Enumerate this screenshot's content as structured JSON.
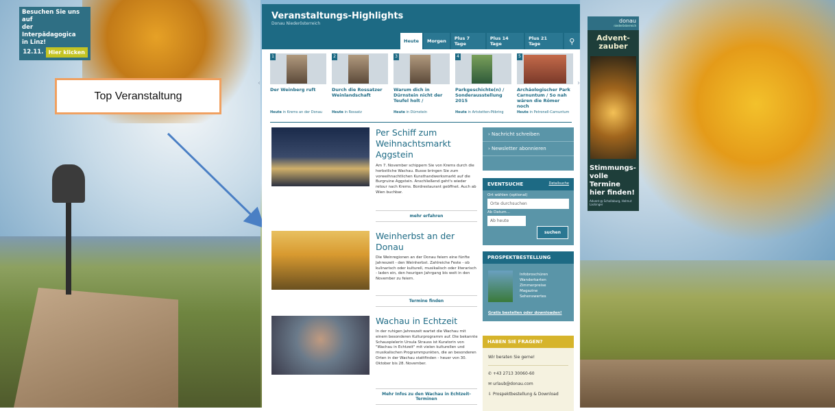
{
  "ad_left": {
    "line1": "Besuchen Sie uns auf",
    "line2": "der Interpädagogica",
    "line3": "in Linz!",
    "dates": "12.11. - 14.11.2015",
    "button": "Hier klicken"
  },
  "annotation": {
    "label": "Top Veranstaltung"
  },
  "header": {
    "title": "Veranstaltungs-Highlights",
    "subtitle": "Donau Niederösterreich"
  },
  "tabs": [
    "Heute",
    "Morgen",
    "Plus 7 Tage",
    "Plus 14 Tage",
    "Plus 21 Tage"
  ],
  "highlights": [
    {
      "num": "1",
      "title": "Der Weinberg ruft",
      "when": "Heute",
      "where": "in Krems an der Donau"
    },
    {
      "num": "2",
      "title": "Durch die Rossatzer Weinlandschaft",
      "when": "Heute",
      "where": "in Rossatz"
    },
    {
      "num": "3",
      "title": "Warum dich in Dürnstein nicht der Teufel holt /",
      "when": "Heute",
      "where": "in Dürnstein"
    },
    {
      "num": "4",
      "title": "Parkgeschichte(n) / Sonderausstellung 2015",
      "when": "Heute",
      "where": "in Artstetten-Pöbring"
    },
    {
      "num": "5",
      "title": "Archäologischer Park Carnuntum / So nah wären die Römer noch",
      "when": "Heute",
      "where": "in Petronell-Carnuntum"
    }
  ],
  "articles": [
    {
      "title": "Per Schiff zum Weihnachtsmarkt Aggstein",
      "text": "Am 7. November schippern Sie von Krems durch die herbstliche Wachau. Busse bringen Sie zum vorweihnachtlichen Kunsthandwerksmarkt auf die Burgruine Aggstein. Anschließend geht's wieder retour nach Krems. Bordrestaurant geöffnet. Auch ab Wien buchbar.",
      "link": "mehr erfahren"
    },
    {
      "title": "Weinherbst an der Donau",
      "text": "Die Weinregionen an der Donau feiern eine fünfte Jahreszeit - den Weinherbst. Zahlreiche Feste - ob kulinarisch oder kulturell, musikalisch oder literarisch - laden ein, den heurigen Jahrgang bis weit in den November zu feiern.",
      "link": "Termine finden"
    },
    {
      "title": "Wachau in Echtzeit",
      "text": "In der ruhigen Jahreszeit wartet die Wachau mit einem besonderen Kulturprogramm auf. Die bekannte Schauspielerin Ursula Strauss ist Kuratorin von \"Wachau in Echtzeit\" mit vielen kulturellen und musikalischen Programmpunkten, die an besonderen Orten in der Wachau stattfinden - heuer von 30. Oktober bis 28. November.",
      "link": "Mehr Infos zu den Wachau in Echtzeit-Terminen"
    }
  ],
  "sidebar": {
    "newsletter": [
      "Nachricht schreiben",
      "Newsletter abonnieren"
    ],
    "eventsuche": {
      "title": "EVENTSUCHE",
      "detail": "Detailsuche",
      "ort_label": "Ort wählen (optional)",
      "ort_placeholder": "Orte durchsuchen",
      "datum_label": "Ab Datum...",
      "datum_value": "Ab heute",
      "button": "suchen"
    },
    "prospekt": {
      "title": "PROSPEKTBESTELLUNG",
      "items": [
        "Infobroschüren",
        "Wanderkarten",
        "Zimmerpreise",
        "Magazine",
        "Sehenswertes"
      ],
      "link": "Gratis bestellen oder downloaden!"
    },
    "fragen": {
      "title": "HABEN SIE FRAGEN?",
      "intro": "Wir beraten Sie gerne!",
      "phone": "+43 2713 30060-60",
      "email": "urlaub@donau.com",
      "download": "Prospektbestellung & Download"
    }
  },
  "ad_right": {
    "logo": "donau",
    "logo_sub": "niederösterreich",
    "line1": "Advent-",
    "line2": "zauber",
    "line3": "Stimmungs-",
    "line4": "volle Termine",
    "line5": "hier finden!",
    "credit": "Advent @ Schallaburg, Helmut Lackinger"
  },
  "colors": {
    "primary": "#1d6a84",
    "sidebar": "#5a95a8",
    "accent": "#d6b42b"
  }
}
